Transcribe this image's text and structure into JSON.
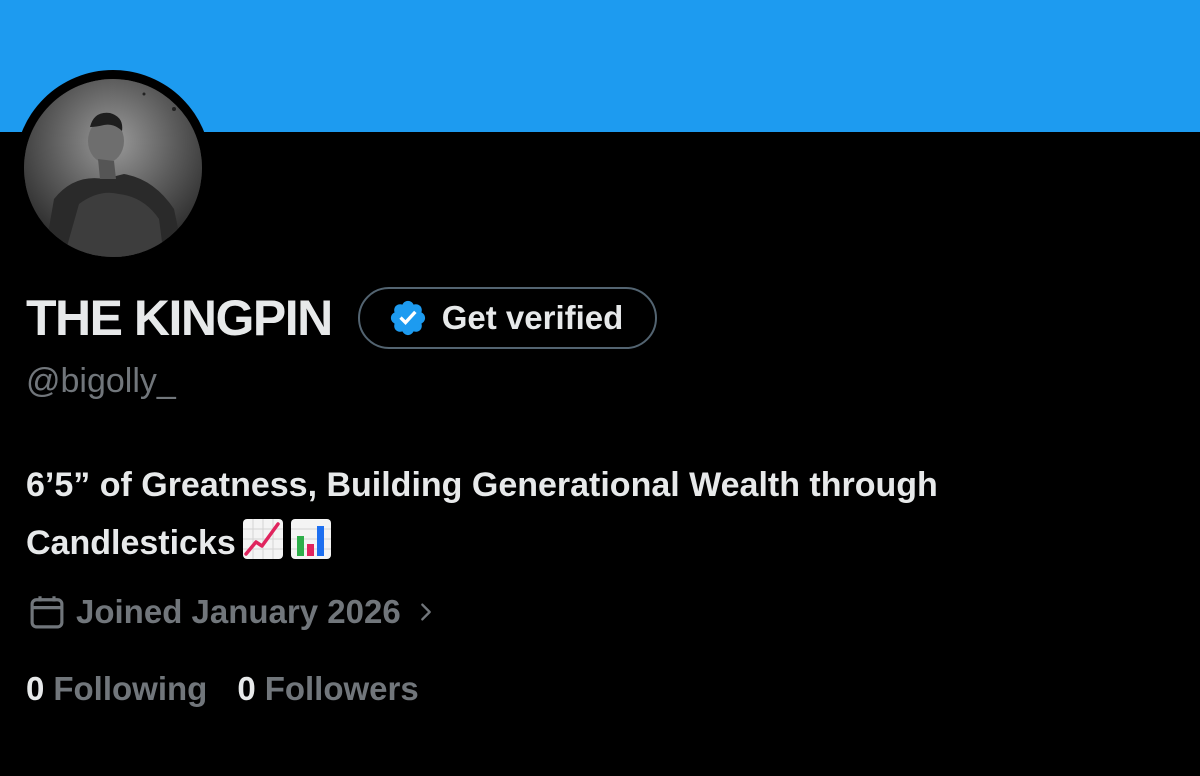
{
  "profile": {
    "display_name": "THE KINGPIN",
    "handle": "@bigolly_",
    "verify_button": {
      "label": "Get verified",
      "icon": "verified-badge-icon"
    },
    "bio": {
      "line1": "6’5” of Greatness, Building Generational Wealth through",
      "line2": "Candlesticks",
      "emojis": [
        "chart-increasing-icon",
        "bar-chart-icon"
      ]
    },
    "joined": {
      "text": "Joined January 2026",
      "icon": "calendar-icon"
    },
    "stats": {
      "following_count": "0",
      "following_label": "Following",
      "followers_count": "0",
      "followers_label": "Followers"
    }
  },
  "colors": {
    "banner": "#1d9bf0",
    "background": "#000000",
    "primary_text": "#e7e9ea",
    "secondary_text": "#71767b",
    "verified_blue": "#1d9bf0",
    "button_border": "#536471"
  }
}
